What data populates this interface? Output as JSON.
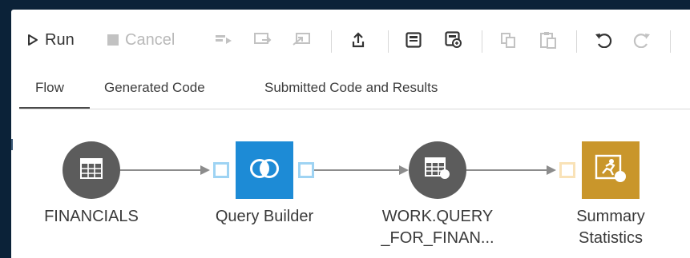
{
  "toolbar": {
    "run_label": "Run",
    "cancel_label": "Cancel"
  },
  "tabs": [
    {
      "label": "Flow",
      "active": true
    },
    {
      "label": "Generated Code",
      "active": false
    },
    {
      "label": "Submitted Code and Results",
      "active": false
    }
  ],
  "flow": {
    "nodes": [
      {
        "label": "FINANCIALS",
        "icon": "table-icon",
        "shape": "circle"
      },
      {
        "label": "Query Builder",
        "icon": "query-builder-icon",
        "shape": "square"
      },
      {
        "label": "WORK.QUERY\n_FOR_FINAN...",
        "icon": "output-table-icon",
        "shape": "circle"
      },
      {
        "label": "Summary\nStatistics",
        "icon": "summary-statistics-icon",
        "shape": "square"
      }
    ]
  },
  "colors": {
    "background": "#0b2238",
    "node_gray": "#5c5c5c",
    "query_builder_blue": "#1d8bd6",
    "summary_stats_gold": "#c9962b",
    "port_blue": "#9ed3f3",
    "port_orange": "#f9e2b7",
    "connector": "#8c8c8c"
  }
}
